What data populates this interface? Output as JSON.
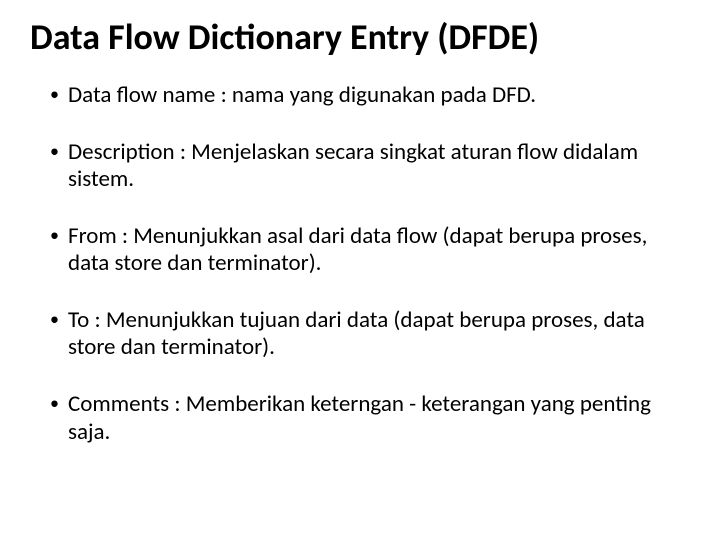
{
  "title": "Data Flow Dictionary Entry (DFDE)",
  "bullets": [
    "Data flow name : nama yang digunakan pada DFD.",
    "Description : Menjelaskan secara singkat aturan flow didalam sistem.",
    "From : Menunjukkan asal dari data flow (dapat berupa proses, data store dan terminator).",
    "To : Menunjukkan tujuan dari data (dapat berupa proses, data store dan terminator).",
    "Comments : Memberikan keterngan - keterangan yang penting saja."
  ]
}
